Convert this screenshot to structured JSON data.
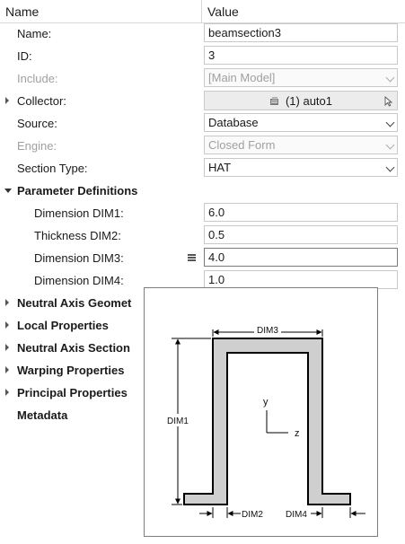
{
  "header": {
    "name_col": "Name",
    "value_col": "Value"
  },
  "fields": {
    "name": {
      "label": "Name:",
      "value": "beamsection3"
    },
    "id": {
      "label": "ID:",
      "value": "3"
    },
    "include": {
      "label": "Include:",
      "value": "[Main Model]"
    },
    "collector": {
      "label": "Collector:",
      "value": "(1) auto1"
    },
    "source": {
      "label": "Source:",
      "value": "Database"
    },
    "engine": {
      "label": "Engine:",
      "value": "Closed Form"
    },
    "section_type": {
      "label": "Section Type:",
      "value": "HAT"
    }
  },
  "parameter_definitions": {
    "label": "Parameter Definitions",
    "dim1": {
      "label": "Dimension DIM1:",
      "value": "6.0"
    },
    "dim2": {
      "label": "Thickness DIM2:",
      "value": "0.5"
    },
    "dim3": {
      "label": "Dimension DIM3:",
      "value": "4.0"
    },
    "dim4": {
      "label": "Dimension DIM4:",
      "value": "1.0"
    }
  },
  "groups": {
    "neutral_axis_geometry": "Neutral Axis Geomet",
    "local_properties": "Local Properties",
    "neutral_axis_section": "Neutral Axis Section",
    "warping_properties": "Warping Properties",
    "principal_properties": "Principal Properties",
    "metadata": "Metadata"
  },
  "diagram": {
    "dim1": "DIM1",
    "dim2": "DIM2",
    "dim3": "DIM3",
    "dim4": "DIM4",
    "axis_y": "y",
    "axis_z": "z"
  },
  "colors": {
    "section_fill": "#cfcfcf",
    "outline": "#000000",
    "disabled_text": "#a0a0a0"
  },
  "icons": {
    "collector": "collector-icon",
    "cursor": "cursor-icon",
    "menu": "menu-icon"
  }
}
